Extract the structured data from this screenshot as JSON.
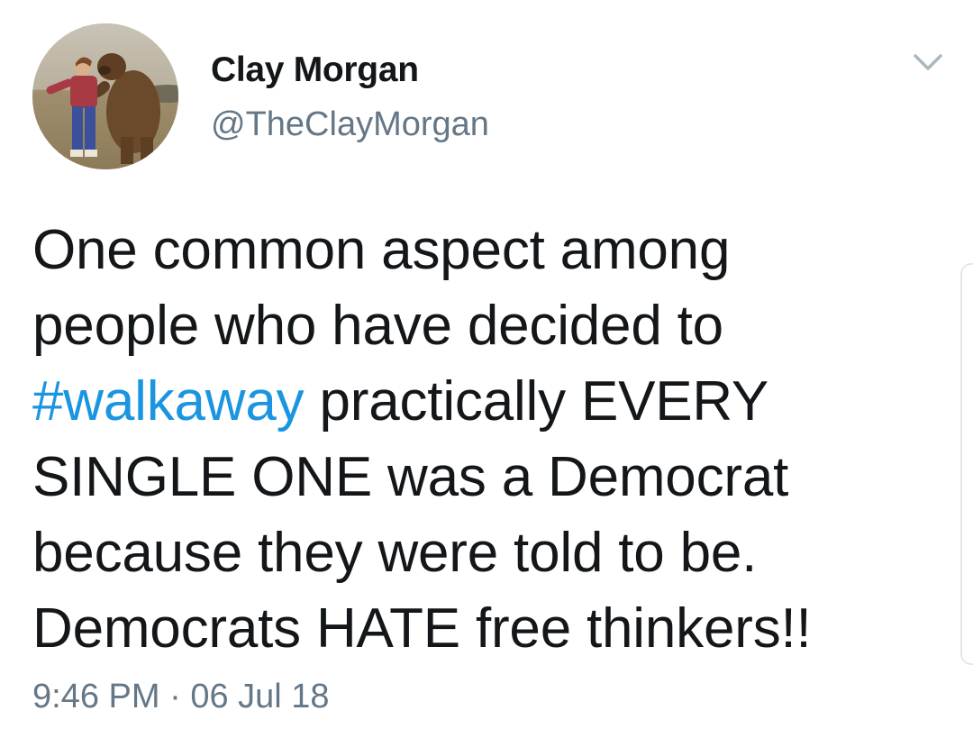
{
  "tweet": {
    "display_name": "Clay Morgan",
    "handle": "@TheClayMorgan",
    "avatar_icon": "profile-photo",
    "menu_icon": "chevron-down-icon",
    "text_lines": [
      {
        "before": "One common aspect among",
        "hashtag": "",
        "after": ""
      },
      {
        "before": "people who have decided to",
        "hashtag": "",
        "after": ""
      },
      {
        "before": "",
        "hashtag": "#walkaway",
        "after": " practically EVERY"
      },
      {
        "before": "SINGLE ONE was a Democrat",
        "hashtag": "",
        "after": ""
      },
      {
        "before": "because they were told to be.",
        "hashtag": "",
        "after": ""
      },
      {
        "before": "Democrats HATE free thinkers!!",
        "hashtag": "",
        "after": ""
      }
    ],
    "time": "9:46 PM",
    "separator": "·",
    "date": "06 Jul 18"
  },
  "colors": {
    "text": "#14171a",
    "secondary": "#657786",
    "link": "#1b95e0",
    "background": "#ffffff"
  }
}
